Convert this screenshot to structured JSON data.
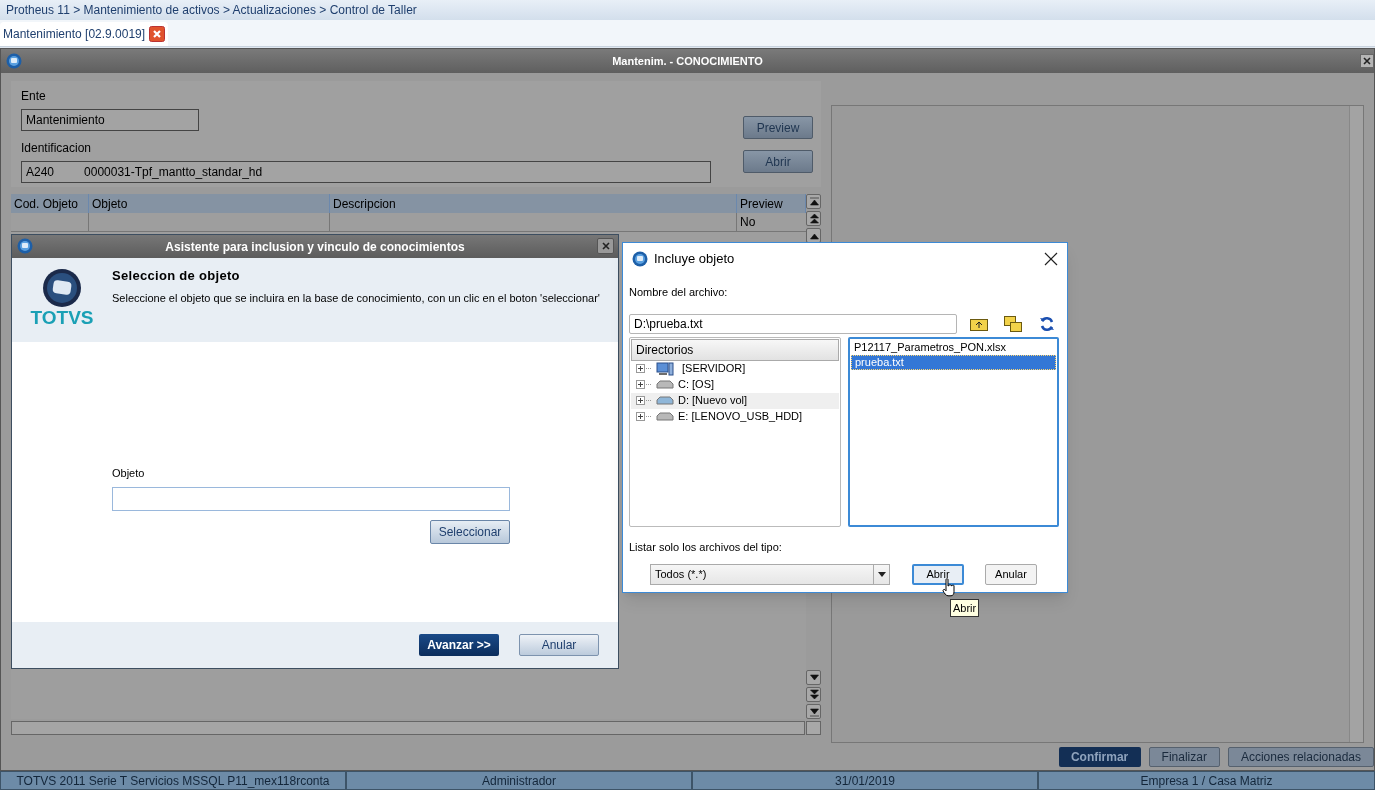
{
  "breadcrumb": "Protheus 11 > Mantenimiento de activos > Actualizaciones > Control de Taller",
  "tabs": [
    {
      "label": "Mantenimiento [02.9.0019]",
      "selected": true
    }
  ],
  "main_window": {
    "title": "Mantenim. - CONOCIMIENTO",
    "ente": {
      "label": "Ente",
      "value": "Mantenimiento"
    },
    "identificacion": {
      "label": "Identificacion",
      "code": "A240",
      "value": "0000031-Tpf_mantto_standar_hd"
    },
    "buttons": [
      "Preview",
      "Abrir"
    ],
    "table": {
      "columns": [
        "Cod. Objeto",
        "Objeto",
        "Descripcion",
        "Preview"
      ],
      "rows": [
        {
          "preview": "No"
        }
      ]
    },
    "actions": [
      {
        "label": "Confirmar",
        "primary": true
      },
      {
        "label": "Finalizar",
        "primary": false
      },
      {
        "label": "Acciones relacionadas",
        "primary": false
      }
    ]
  },
  "status_bar": [
    "TOTVS 2011 Serie T Servicios MSSQL P11_mex118rconta",
    "Administrador",
    "31/01/2019",
    "Empresa 1 / Casa Matriz"
  ],
  "wizard": {
    "title": "Asistente para inclusion y vinculo de conocimientos",
    "logo_text": "TOTVS",
    "heading": "Seleccion de objeto",
    "description": "Seleccione el objeto que se incluira en la base de conocimiento, con un clic en el boton 'seleccionar'",
    "field_label": "Objeto",
    "select_button": "Seleccionar",
    "buttons": [
      {
        "label": "Avanzar >>",
        "primary": true
      },
      {
        "label": "Anular",
        "primary": false
      }
    ]
  },
  "file_dialog": {
    "title": "Incluye objeto",
    "filename_label": "Nombre del archivo:",
    "filename": "D:\\prueba.txt",
    "tree_header": "Directorios",
    "directories": [
      {
        "label": "[SERVIDOR]",
        "kind": "server",
        "selected": false
      },
      {
        "label": "C: [OS]",
        "kind": "drive",
        "selected": false
      },
      {
        "label": "D: [Nuevo vol]",
        "kind": "drive",
        "selected": true
      },
      {
        "label": "E: [LENOVO_USB_HDD]",
        "kind": "drive",
        "selected": false
      }
    ],
    "files": [
      {
        "label": "P12117_Parametros_PON.xlsx",
        "selected": false
      },
      {
        "label": "prueba.txt",
        "selected": true
      }
    ],
    "filter_label": "Listar solo los archivos del tipo:",
    "filter": "Todos (*.*)",
    "buttons": [
      {
        "label": "Abrir",
        "focused": true
      },
      {
        "label": "Anular",
        "focused": false
      }
    ],
    "tooltip": "Abrir"
  }
}
